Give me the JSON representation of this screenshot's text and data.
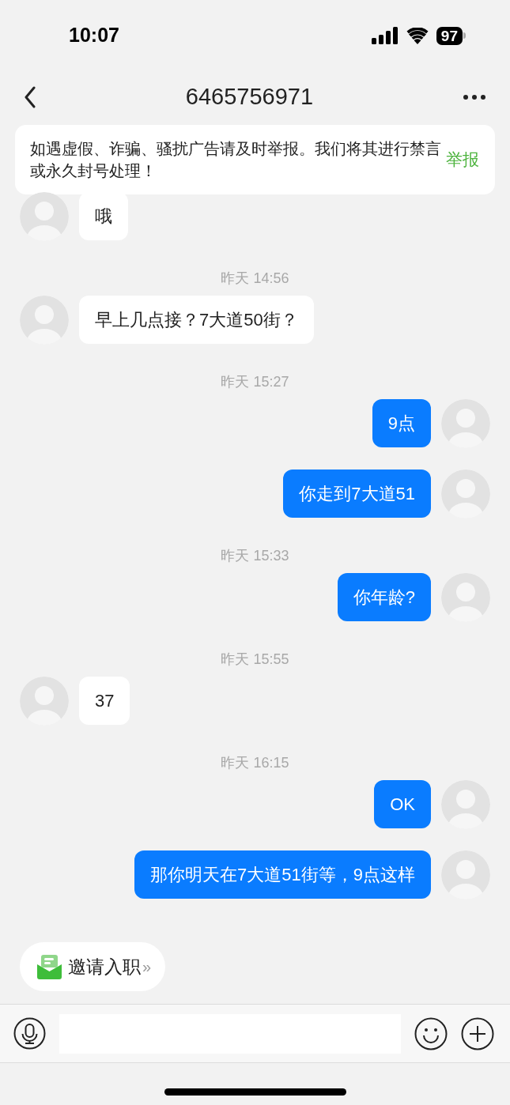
{
  "status_bar": {
    "time": "10:07",
    "battery": "97"
  },
  "header": {
    "title": "6465756971"
  },
  "notice": {
    "text": "如遇虚假、诈骗、骚扰广告请及时举报。我们将其进行禁言或永久封号处理！",
    "action": "举报"
  },
  "messages": [
    {
      "kind": "incoming",
      "text": "哦"
    },
    {
      "kind": "time",
      "text": "昨天 14:56"
    },
    {
      "kind": "incoming",
      "text": "早上几点接？7大道50街？"
    },
    {
      "kind": "time",
      "text": "昨天 15:27"
    },
    {
      "kind": "outgoing",
      "text": "9点"
    },
    {
      "kind": "outgoing",
      "text": "你走到7大道51"
    },
    {
      "kind": "time",
      "text": "昨天 15:33"
    },
    {
      "kind": "outgoing",
      "text": "你年龄?"
    },
    {
      "kind": "time",
      "text": "昨天 15:55"
    },
    {
      "kind": "incoming",
      "text": "37"
    },
    {
      "kind": "time",
      "text": "昨天 16:15"
    },
    {
      "kind": "outgoing",
      "text": "OK"
    },
    {
      "kind": "outgoing",
      "text": "那你明天在7大道51街等，9点这样"
    }
  ],
  "invite": {
    "label": "邀请入职",
    "arrow": "»"
  }
}
